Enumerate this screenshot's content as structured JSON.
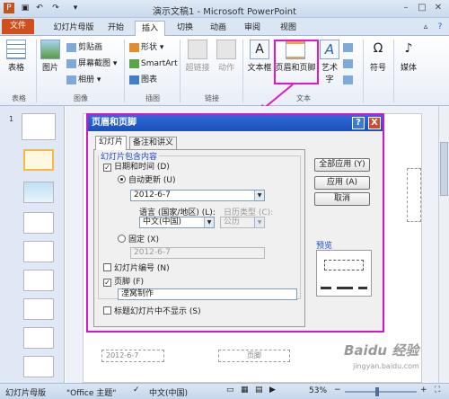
{
  "window": {
    "title": "演示文稿1 - Microsoft PowerPoint"
  },
  "tabs": [
    {
      "label": "文件"
    },
    {
      "label": "幻灯片母版"
    },
    {
      "label": "开始"
    },
    {
      "label": "插入"
    },
    {
      "label": "切换"
    },
    {
      "label": "动画"
    },
    {
      "label": "审阅"
    },
    {
      "label": "视图"
    }
  ],
  "ribbon": {
    "table": "表格",
    "picture": "图片",
    "clipart": "剪贴画",
    "screenshot": "屏幕截图",
    "album": "相册",
    "shapes": "形状",
    "smartart": "SmartArt",
    "chart": "图表",
    "hyperlink": "超链接",
    "action": "动作",
    "textbox": "文本框",
    "headerfooter": "页眉和页脚",
    "wordart": "艺术字",
    "symbol": "符号",
    "media": "媒体",
    "groups": {
      "table": "表格",
      "images": "图像",
      "illustrations": "插图",
      "links": "链接",
      "text": "文本"
    }
  },
  "thumbs": {
    "first_number": "1"
  },
  "dialog": {
    "title": "页眉和页脚",
    "help": "?",
    "close": "X",
    "tab_slide": "幻灯片",
    "tab_notes": "备注和讲义",
    "group_title": "幻灯片包含内容",
    "datetime": "日期和时间 (D)",
    "auto_update": "自动更新 (U)",
    "date_value": "2012-6-7",
    "language_label": "语言 (国家/地区) (L):",
    "calendar_label": "日历类型 (C):",
    "language_value": "中文(中国)",
    "calendar_value": "公历",
    "fixed": "固定 (X)",
    "fixed_value": "2012-6-7",
    "slide_number": "幻灯片编号 (N)",
    "footer": "页脚 (F)",
    "footer_value": "湮窝制作",
    "hide_title": "标题幻灯片中不显示 (S)",
    "apply_all": "全部应用 (Y)",
    "apply": "应用 (A)",
    "cancel": "取消",
    "preview": "预览"
  },
  "slide_footer": {
    "date": "2012-6-7",
    "center": "页脚",
    "watermark": "Baidu 经验",
    "url": "jingyan.baidu.com"
  },
  "status": {
    "view": "幻灯片母版",
    "theme": "\"Office 主题\"",
    "lang": "中文(中国)",
    "zoom": "53%"
  }
}
